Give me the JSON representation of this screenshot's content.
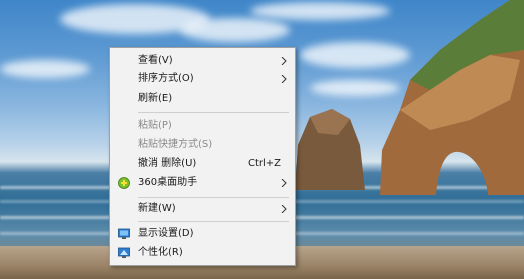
{
  "context_menu": {
    "items": [
      {
        "label": "查看(V)",
        "has_submenu": true
      },
      {
        "label": "排序方式(O)",
        "has_submenu": true
      },
      {
        "label": "刷新(E)",
        "has_submenu": false
      },
      {
        "label": "粘贴(P)",
        "disabled": true
      },
      {
        "label": "粘贴快捷方式(S)",
        "disabled": true
      },
      {
        "label": "撤消 删除(U)",
        "shortcut": "Ctrl+Z"
      },
      {
        "label": "360桌面助手",
        "has_submenu": true,
        "icon": "360-desktop-helper-icon"
      },
      {
        "label": "新建(W)",
        "has_submenu": true
      },
      {
        "label": "显示设置(D)",
        "icon": "display-settings-icon"
      },
      {
        "label": "个性化(R)",
        "icon": "personalize-icon"
      }
    ]
  },
  "colors": {
    "menu_background": "#f2f2f2",
    "disabled_text": "#8a8a8a",
    "separator": "#cfcfcf"
  }
}
